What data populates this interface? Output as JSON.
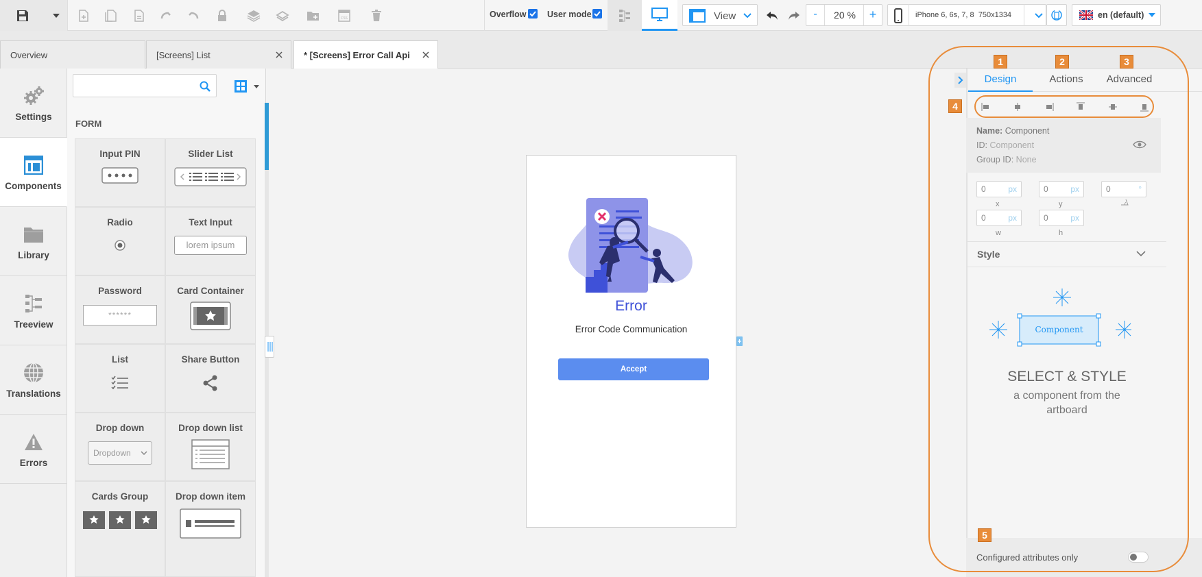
{
  "toolbar": {
    "icons": [
      "save-icon",
      "save-dropdown-icon",
      "new-page-icon",
      "duplicate-page-icon",
      "copy-page-icon",
      "undo-redo-icon",
      "redo-style-icon",
      "lock-icon",
      "layers-icon",
      "layers-alt-icon",
      "folder-add-icon",
      "css-icon",
      "trash-icon"
    ],
    "overflow_label": "Overflow",
    "overflow_checked": true,
    "usermode_label": "User mode",
    "usermode_checked": true,
    "view_label": "View",
    "zoom_minus": "-",
    "zoom_value": "20 %",
    "zoom_plus": "+",
    "device_label": "iPhone 6, 6s, 7, 8  750x1334",
    "language_label": "en (default)"
  },
  "tabs": [
    {
      "label": "Overview",
      "closable": false,
      "active": false
    },
    {
      "label": "[Screens] List",
      "closable": true,
      "active": false
    },
    {
      "label": "* [Screens] Error Call Api",
      "closable": true,
      "active": true
    }
  ],
  "leftnav": [
    {
      "label": "Settings",
      "icon": "gears-icon"
    },
    {
      "label": "Components",
      "icon": "components-icon",
      "active": true
    },
    {
      "label": "Library",
      "icon": "folder-icon"
    },
    {
      "label": "Treeview",
      "icon": "treeview-icon"
    },
    {
      "label": "Translations",
      "icon": "globe-icon"
    },
    {
      "label": "Errors",
      "icon": "warning-icon"
    }
  ],
  "components_panel": {
    "search_placeholder": "",
    "section_title": "FORM",
    "items": [
      {
        "title": "Input PIN",
        "preview": "pin"
      },
      {
        "title": "Slider List",
        "preview": "slider"
      },
      {
        "title": "Radio",
        "preview": "radio"
      },
      {
        "title": "Text Input",
        "preview": "text",
        "preview_text": "lorem ipsum"
      },
      {
        "title": "Password",
        "preview": "password",
        "preview_text": "******"
      },
      {
        "title": "Card Container",
        "preview": "card"
      },
      {
        "title": "List",
        "preview": "list"
      },
      {
        "title": "Share Button",
        "preview": "share"
      },
      {
        "title": "Drop down",
        "preview": "dropdown",
        "preview_text": "Dropdown"
      },
      {
        "title": "Drop down list",
        "preview": "ddlist"
      },
      {
        "title": "Cards Group",
        "preview": "cards"
      },
      {
        "title": "Drop down item",
        "preview": "dditem"
      }
    ]
  },
  "artboard": {
    "title": "Error",
    "subtitle": "Error Code Communication",
    "button_label": "Accept",
    "accent_color": "#3f51d8",
    "button_color": "#5b8def"
  },
  "right_panel": {
    "tabs": [
      {
        "label": "Design",
        "badge": "1",
        "active": true
      },
      {
        "label": "Actions",
        "badge": "2"
      },
      {
        "label": "Advanced",
        "badge": "3"
      }
    ],
    "align_badge": "4",
    "align_icons": [
      "align-left-icon",
      "align-center-h-icon",
      "align-right-icon",
      "align-top-icon",
      "align-middle-v-icon",
      "align-bottom-icon"
    ],
    "name_label": "Name:",
    "name_value": "Component",
    "id_label": "ID:",
    "id_value": "Component",
    "group_label": "Group ID:",
    "group_value": "None",
    "fields": [
      {
        "value": "0",
        "unit": "px",
        "label": "x"
      },
      {
        "value": "0",
        "unit": "px",
        "label": "y"
      },
      {
        "value": "0",
        "unit": "°",
        "label": ""
      },
      {
        "value": "0",
        "unit": "px",
        "label": "w"
      },
      {
        "value": "0",
        "unit": "px",
        "label": "h"
      }
    ],
    "style_label": "Style",
    "illustration_label": "Component",
    "select_title": "SELECT & STYLE",
    "select_subtitle": "a component from the artboard",
    "footer_badge": "5",
    "footer_label": "Configured attributes only",
    "footer_toggle_on": false,
    "highlight_color": "#e88c3a"
  }
}
